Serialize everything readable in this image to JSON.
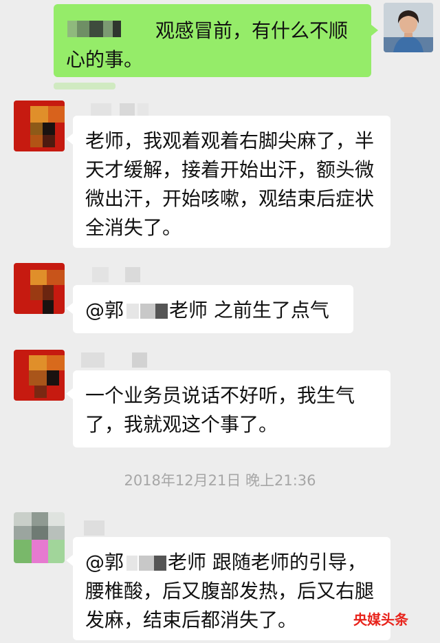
{
  "messages": {
    "m1": {
      "text": "观感冒前，有什么不顺心的事。"
    },
    "m2": {
      "text": "老师，我观着观着右脚尖麻了，半天才缓解，接着开始出汗，额头微微出汗，开始咳嗽，观结束后症状全消失了。"
    },
    "m3": {
      "prefix": "@郭",
      "suffix": "老师  之前生了点气"
    },
    "m4": {
      "text": "一个业务员说话不好听，我生气了，我就观这个事了。"
    },
    "m5": {
      "prefix": "@郭",
      "suffix": "老师  跟随老师的引导，腰椎酸，后又腹部发热，后又右腿发麻，结束后都消失了。"
    }
  },
  "timestamp": "2018年12月21日 晚上21:36",
  "watermark": "央媒头条",
  "colors": {
    "outgoing_bubble": "#95ec69",
    "incoming_bubble": "#ffffff",
    "background": "#ededed",
    "watermark": "#e8231b"
  }
}
